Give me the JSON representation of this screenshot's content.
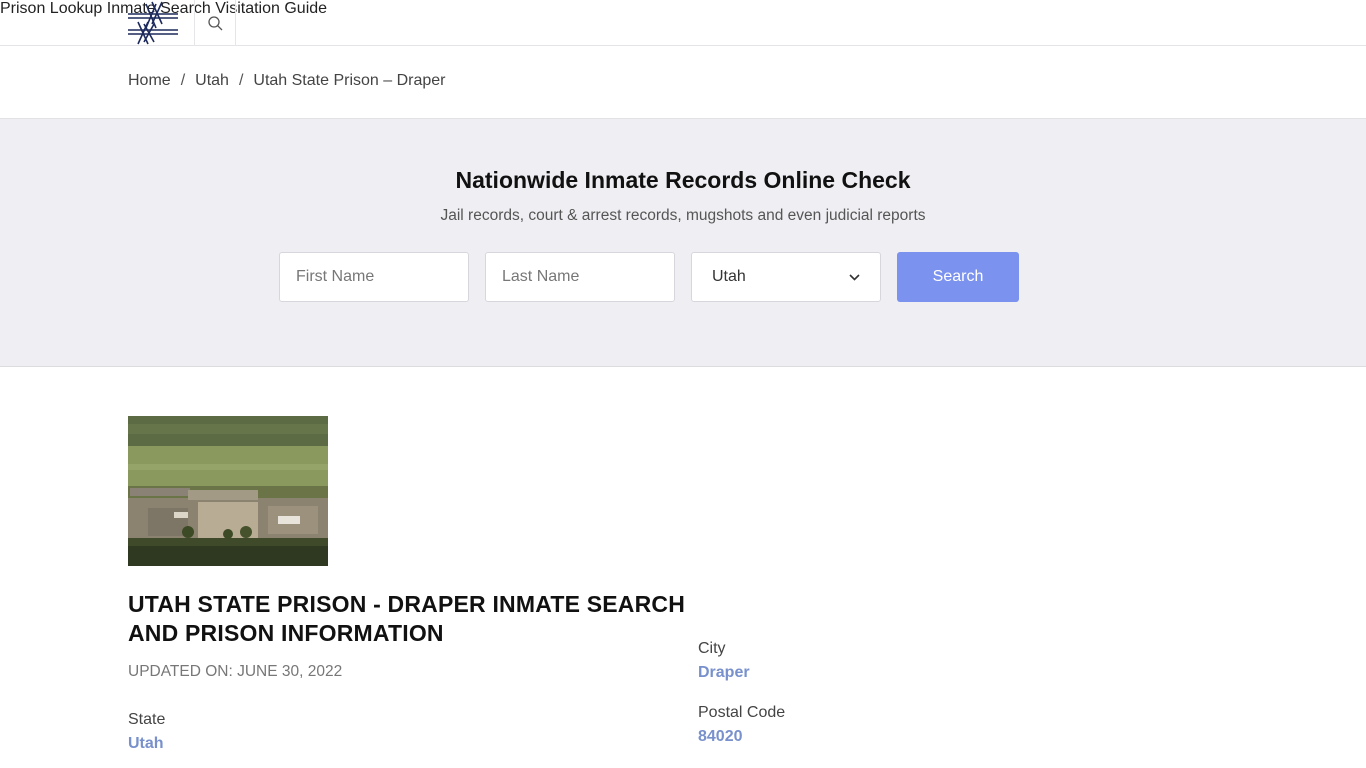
{
  "header": {
    "nav": [
      "Prison Lookup",
      "Inmate Search",
      "Visitation Guide"
    ]
  },
  "breadcrumb": {
    "items": [
      "Home",
      "Utah",
      "Utah State Prison – Draper"
    ],
    "separator": "/"
  },
  "hero": {
    "title": "Nationwide Inmate Records Online Check",
    "subtitle": "Jail records, court & arrest records, mugshots and even judicial reports",
    "first_name_placeholder": "First Name",
    "last_name_placeholder": "Last Name",
    "state_selected": "Utah",
    "search_label": "Search",
    "button_color": "#7b93ee"
  },
  "content": {
    "title": "UTAH STATE PRISON - DRAPER INMATE SEARCH AND PRISON INFORMATION",
    "updated": "UPDATED ON: JUNE 30, 2022",
    "state_label": "State",
    "state_value": "Utah",
    "city_label": "City",
    "city_value": "Draper",
    "postal_label": "Postal Code",
    "postal_value": "84020"
  },
  "colors": {
    "nav_text": "#1d2a5c",
    "link_value": "#7890cc",
    "hero_bg": "#efeff3"
  },
  "icons": [
    "barbed-wire-logo-icon",
    "search-icon",
    "chevron-down-icon"
  ]
}
